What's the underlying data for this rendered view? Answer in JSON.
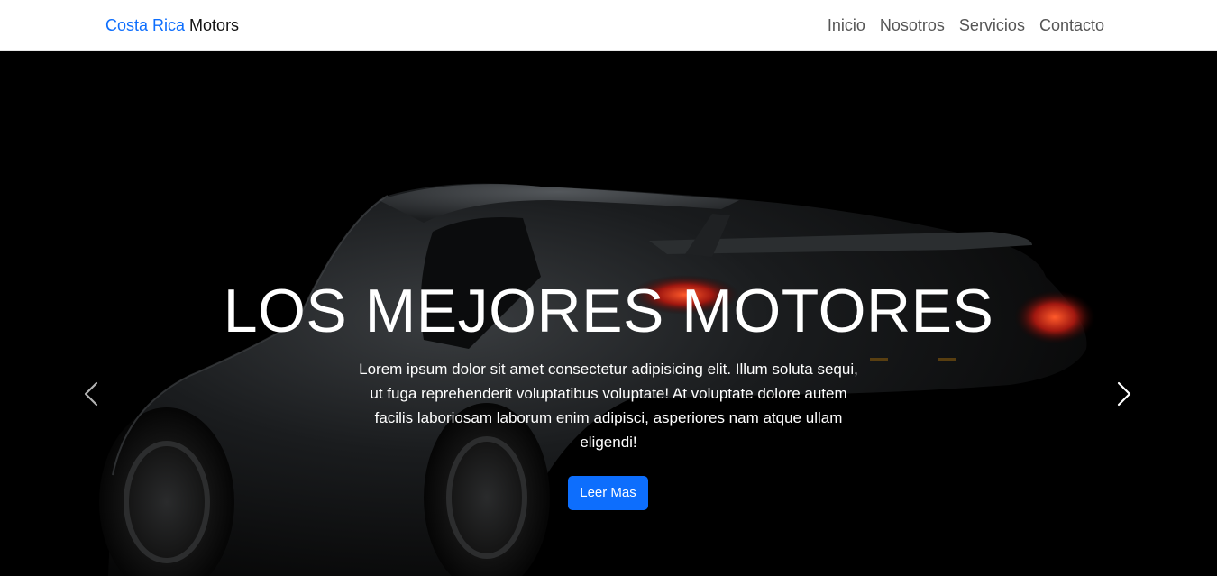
{
  "navbar": {
    "brand_accent": "Costa Rica",
    "brand_main": "Motors",
    "links": [
      {
        "label": "Inicio"
      },
      {
        "label": "Nosotros"
      },
      {
        "label": "Servicios"
      },
      {
        "label": "Contacto"
      }
    ]
  },
  "hero": {
    "title": "LOS MEJORES MOTORES",
    "text": "Lorem ipsum dolor sit amet consectetur adipisicing elit. Illum soluta sequi, ut fuga reprehenderit voluptatibus voluptate! At voluptate dolore autem facilis laboriosam laborum enim adipisci, asperiores nam atque ullam eligendi!",
    "button_label": "Leer Mas",
    "prev_icon": "chevron-left-icon",
    "next_icon": "chevron-right-icon"
  },
  "colors": {
    "accent": "#0d6efd",
    "navbar_bg": "#ffffff",
    "hero_bg": "#000000",
    "nav_text": "#555555"
  }
}
